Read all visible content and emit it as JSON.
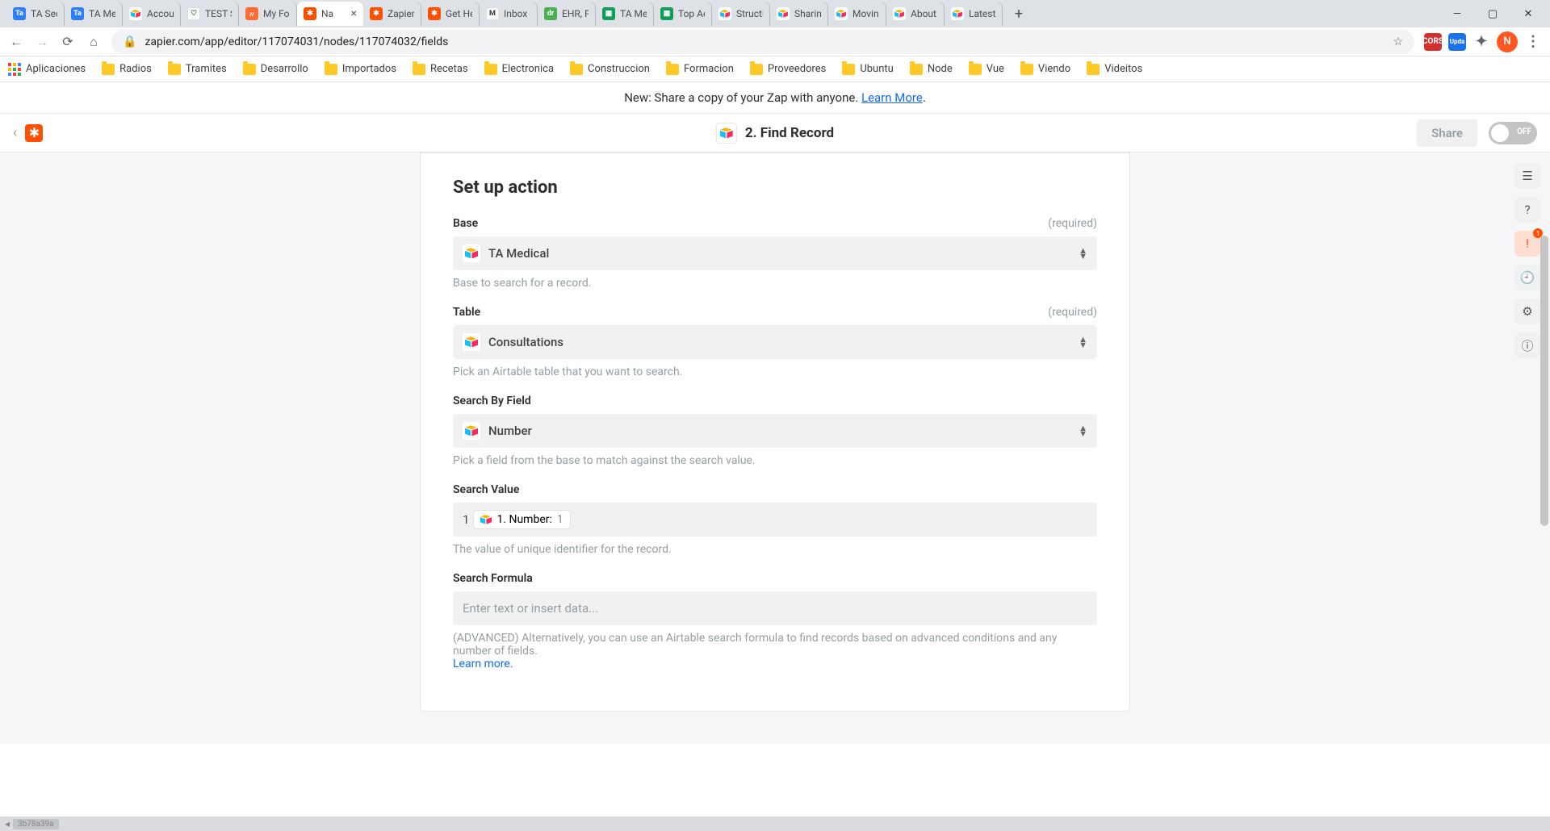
{
  "browser": {
    "tabs": [
      {
        "title": "TA Sec",
        "favicon": "Ta",
        "color": "#2d7ff9"
      },
      {
        "title": "TA Me",
        "favicon": "Ta",
        "color": "#2d7ff9"
      },
      {
        "title": "Accou",
        "favicon": "at",
        "color": "#ffffff"
      },
      {
        "title": "TEST S",
        "favicon": "♡",
        "color": "#ffffff"
      },
      {
        "title": "My Fo",
        "favicon": "〃",
        "color": "#ff6b35"
      },
      {
        "title": "Na",
        "favicon": "✱",
        "color": "#ff4f00",
        "active": true
      },
      {
        "title": "Zapier",
        "favicon": "✱",
        "color": "#ff4f00"
      },
      {
        "title": "Get He",
        "favicon": "✱",
        "color": "#ff4f00"
      },
      {
        "title": "Inbox",
        "favicon": "M",
        "color": "#ffffff"
      },
      {
        "title": "EHR, P",
        "favicon": "dr",
        "color": "#4caf50"
      },
      {
        "title": "TA Me",
        "favicon": "▦",
        "color": "#0f9d58"
      },
      {
        "title": "Top Ae",
        "favicon": "▦",
        "color": "#0f9d58"
      },
      {
        "title": "Structu",
        "favicon": "at",
        "color": "#ffffff"
      },
      {
        "title": "Sharin",
        "favicon": "at",
        "color": "#ffffff"
      },
      {
        "title": "Movin",
        "favicon": "at",
        "color": "#ffffff"
      },
      {
        "title": "About",
        "favicon": "at",
        "color": "#ffffff"
      },
      {
        "title": "Latest",
        "favicon": "at",
        "color": "#ffffff"
      }
    ],
    "url": "zapier.com/app/editor/117074031/nodes/117074032/fields",
    "avatar": "N",
    "ext_cors": "CORS",
    "ext_upda": "Upda"
  },
  "bookmarks": {
    "apps_label": "Aplicaciones",
    "items": [
      "Radios",
      "Tramites",
      "Desarrollo",
      "Importados",
      "Recetas",
      "Electronica",
      "Construccion",
      "Formacion",
      "Proveedores",
      "Ubuntu",
      "Node",
      "Vue",
      "Viendo",
      "Videitos"
    ]
  },
  "notice": {
    "text": "New: Share a copy of your Zap with anyone. ",
    "link": "Learn More",
    "dot": "."
  },
  "header": {
    "step_title": "2. Find Record",
    "share": "Share",
    "toggle": "OFF"
  },
  "panel": {
    "title": "Set up action",
    "required": "(required)",
    "fields": {
      "base": {
        "label": "Base",
        "value": "TA Medical",
        "help": "Base to search for a record."
      },
      "table": {
        "label": "Table",
        "value": "Consultations",
        "help": "Pick an Airtable table that you want to search."
      },
      "search_by": {
        "label": "Search By Field",
        "value": "Number",
        "help": "Pick a field from the base to match against the search value."
      },
      "search_value": {
        "label": "Search Value",
        "prefix": "1",
        "pill_step": "1. Number:",
        "pill_value": "1",
        "help": "The value of unique identifier for the record."
      },
      "search_formula": {
        "label": "Search Formula",
        "placeholder": "Enter text or insert data...",
        "help": "(ADVANCED) Alternatively, you can use an Airtable search formula to find records based on advanced conditions and any number of fields. ",
        "learn_more": "Learn more."
      }
    }
  },
  "rail": {
    "badge": "1"
  },
  "bottom": "3b78a39a"
}
